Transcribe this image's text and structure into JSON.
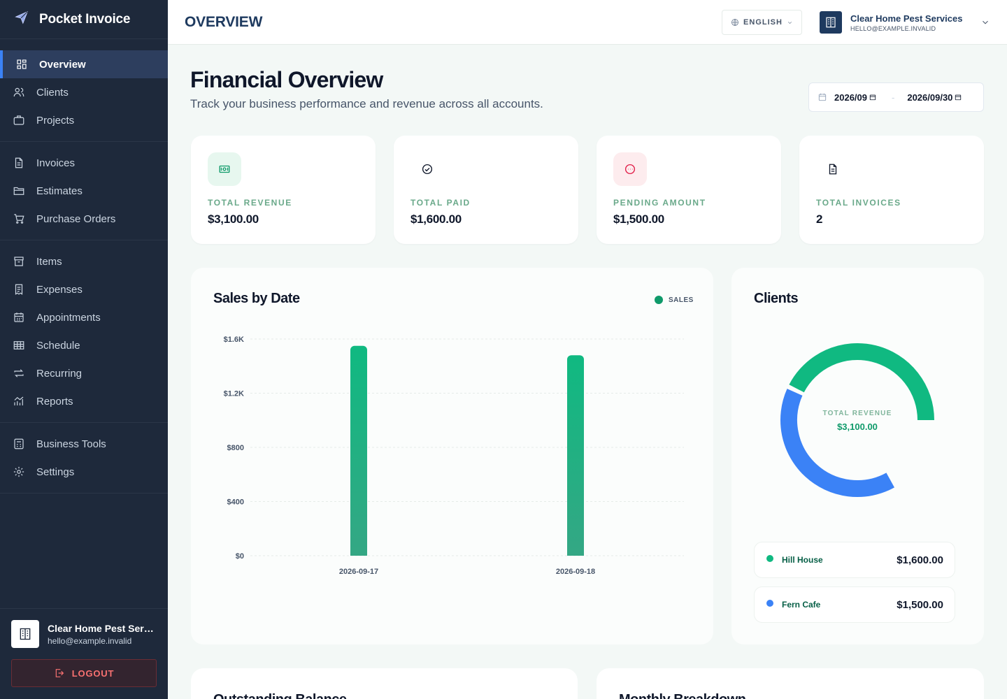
{
  "app": {
    "name": "Pocket Invoice"
  },
  "sidebar": {
    "groups": [
      [
        {
          "label": "Overview",
          "icon": "grid-icon",
          "active": true
        },
        {
          "label": "Clients",
          "icon": "users-icon"
        },
        {
          "label": "Projects",
          "icon": "briefcase-icon"
        }
      ],
      [
        {
          "label": "Invoices",
          "icon": "file-icon"
        },
        {
          "label": "Estimates",
          "icon": "folder-icon"
        },
        {
          "label": "Purchase Orders",
          "icon": "cart-icon"
        }
      ],
      [
        {
          "label": "Items",
          "icon": "archive-icon"
        },
        {
          "label": "Expenses",
          "icon": "receipt-icon"
        },
        {
          "label": "Appointments",
          "icon": "calendar-icon"
        },
        {
          "label": "Schedule",
          "icon": "table-icon"
        },
        {
          "label": "Recurring",
          "icon": "repeat-icon"
        },
        {
          "label": "Reports",
          "icon": "chart-icon"
        }
      ],
      [
        {
          "label": "Business Tools",
          "icon": "calculator-icon"
        },
        {
          "label": "Settings",
          "icon": "gear-icon"
        }
      ]
    ],
    "user": {
      "name": "Clear Home Pest Services",
      "email": "hello@example.invalid"
    },
    "logout_label": "LOGOUT"
  },
  "topbar": {
    "title": "OVERVIEW",
    "language": "ENGLISH",
    "account_name": "Clear Home Pest Services",
    "account_email": "HELLO@EXAMPLE.INVALID"
  },
  "main": {
    "heading": "Financial Overview",
    "subheading": "Track your business performance and revenue across all accounts.",
    "date_from": "2026/09",
    "date_to": "2026/09/30",
    "date_separator": "-"
  },
  "stats": [
    {
      "label": "TOTAL REVENUE",
      "value": "$3,100.00",
      "icon": "money-icon"
    },
    {
      "label": "TOTAL PAID",
      "value": "$1,600.00",
      "icon": "check-circle-icon"
    },
    {
      "label": "PENDING AMOUNT",
      "value": "$1,500.00",
      "icon": "dots-circle-icon"
    },
    {
      "label": "TOTAL INVOICES",
      "value": "2",
      "icon": "document-icon"
    }
  ],
  "sales_card": {
    "title": "Sales by Date",
    "legend_label": "SALES"
  },
  "clients_card": {
    "title": "Clients",
    "center_label": "TOTAL REVENUE",
    "center_value": "$3,100.00",
    "rows": [
      {
        "name": "Hill House",
        "amount": "$1,600.00",
        "color": "#10b981"
      },
      {
        "name": "Fern Cafe",
        "amount": "$1,500.00",
        "color": "#3b82f6"
      }
    ]
  },
  "bottom_cards": [
    {
      "title": "Outstanding Balance"
    },
    {
      "title": "Monthly Breakdown"
    }
  ],
  "colors": {
    "accent": "#3b82f6",
    "sales": "#10b981",
    "sidebar": "#1e293b"
  },
  "chart_data": [
    {
      "type": "bar",
      "title": "Sales by Date",
      "categories": [
        "2026-09-17",
        "2026-09-18"
      ],
      "series": [
        {
          "name": "SALES",
          "values": [
            1550,
            1480
          ]
        }
      ],
      "y_ticks": [
        "$0",
        "$400",
        "$800",
        "$1.2K",
        "$1.6K"
      ],
      "ylim": [
        0,
        1600
      ],
      "grid": true,
      "legend": "top-right"
    },
    {
      "type": "pie",
      "categories": [
        "Hill House",
        "Fern Cafe"
      ],
      "values": [
        1600,
        1500
      ]
    }
  ]
}
